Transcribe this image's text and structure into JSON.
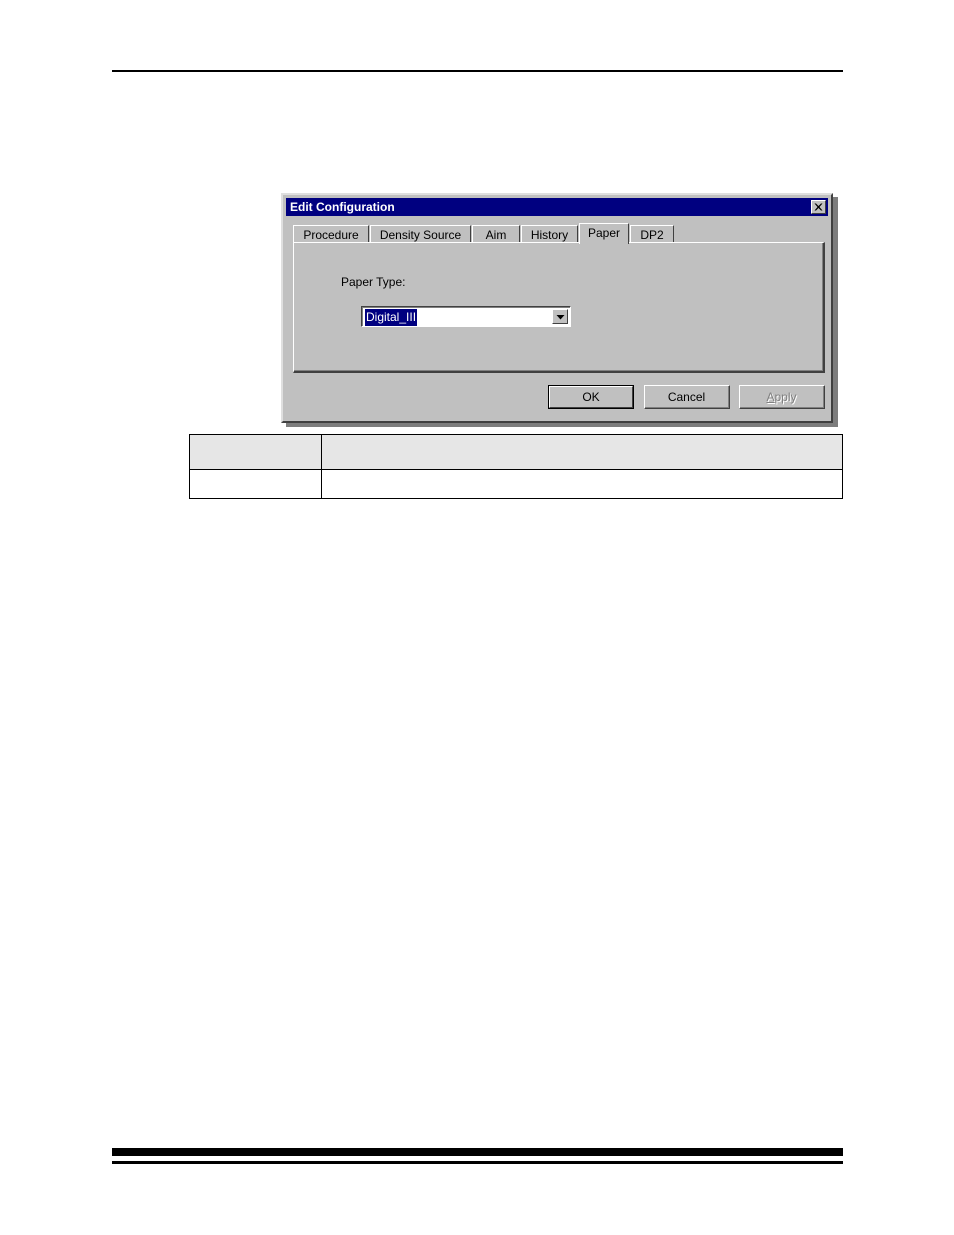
{
  "page": {
    "header_rule": "",
    "footer_bar": "",
    "footer_rule": ""
  },
  "dialog": {
    "title": "Edit Configuration",
    "close_icon": "close-x-icon",
    "titlebar_color": "#000080",
    "face_color": "#c0c0c0",
    "tabs": [
      {
        "label": "Procedure",
        "selected": false
      },
      {
        "label": "Density Source",
        "selected": false
      },
      {
        "label": "Aim",
        "selected": false
      },
      {
        "label": "History",
        "selected": false
      },
      {
        "label": "Paper",
        "selected": true
      },
      {
        "label": "DP2",
        "selected": false
      }
    ],
    "paper_tab": {
      "field_label": "Paper Type:",
      "paper_type": {
        "value": "Digital_III",
        "selected": true,
        "highlight_color": "#000080",
        "arrow_icon": "chevron-down-icon"
      }
    },
    "buttons": {
      "ok": "OK",
      "cancel": "Cancel",
      "apply": "Apply",
      "apply_enabled": false,
      "default_button": "OK"
    }
  },
  "doc_table": {
    "columns": [
      "",
      ""
    ],
    "rows": [
      {
        "cells": [
          "",
          ""
        ],
        "kind": "header"
      },
      {
        "cells": [
          "",
          ""
        ],
        "kind": "body"
      }
    ]
  }
}
